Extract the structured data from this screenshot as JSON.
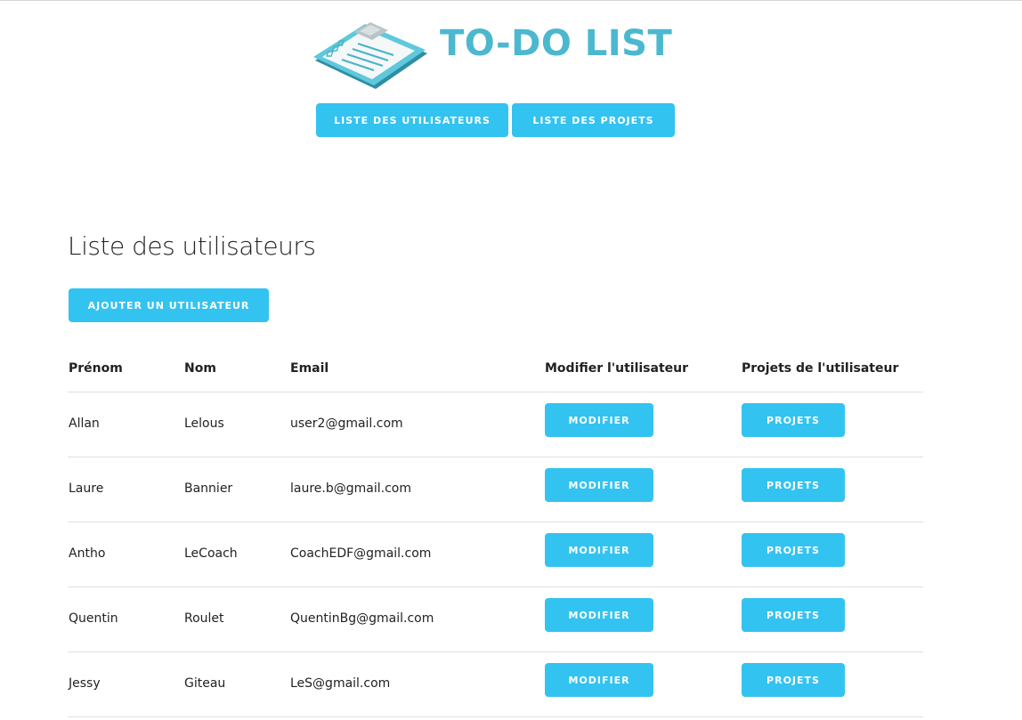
{
  "header": {
    "logo_text": "TO-DO LIST",
    "nav": [
      {
        "label": "LISTE DES UTILISATEURS"
      },
      {
        "label": "LISTE DES PROJETS"
      }
    ]
  },
  "main": {
    "title": "Liste des utilisateurs",
    "add_button": "AJOUTER UN UTILISATEUR",
    "columns": [
      "Prénom",
      "Nom",
      "Email",
      "Modifier l'utilisateur",
      "Projets de l'utilisateur"
    ],
    "rows": [
      {
        "prenom": "Allan",
        "nom": "Lelous",
        "email": "user2@gmail.com",
        "modifier": "MODIFIER",
        "projets": "PROJETS"
      },
      {
        "prenom": "Laure",
        "nom": "Bannier",
        "email": "laure.b@gmail.com",
        "modifier": "MODIFIER",
        "projets": "PROJETS"
      },
      {
        "prenom": "Antho",
        "nom": "LeCoach",
        "email": "CoachEDF@gmail.com",
        "modifier": "MODIFIER",
        "projets": "PROJETS"
      },
      {
        "prenom": "Quentin",
        "nom": "Roulet",
        "email": "QuentinBg@gmail.com",
        "modifier": "MODIFIER",
        "projets": "PROJETS"
      },
      {
        "prenom": "Jessy",
        "nom": "Giteau",
        "email": "LeS@gmail.com",
        "modifier": "MODIFIER",
        "projets": "PROJETS"
      }
    ]
  },
  "colors": {
    "accent": "#33c3f0",
    "logo": "#4bb8cf"
  },
  "icons": {
    "logo": "clipboard-checklist-icon"
  }
}
